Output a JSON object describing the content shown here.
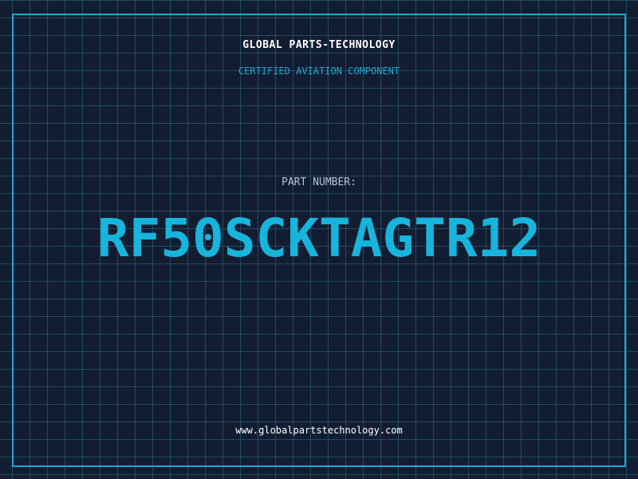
{
  "header": {
    "company": "GLOBAL PARTS-TECHNOLOGY",
    "tagline": "CERTIFIED AVIATION COMPONENT"
  },
  "part": {
    "label": "PART NUMBER:",
    "number": "RF50SCKTAGTR12"
  },
  "footer": {
    "website": "www.globalpartstechnology.com"
  },
  "colors": {
    "background": "#131d32",
    "accent": "#1fa8cf",
    "part_number": "#17b4dc",
    "grid": "#2a6e8c"
  }
}
